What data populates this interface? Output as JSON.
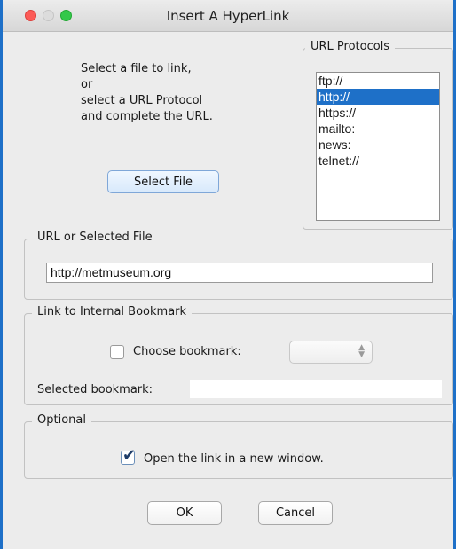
{
  "window": {
    "title": "Insert A HyperLink",
    "accent_color": "#1e70c8"
  },
  "instructions": [
    "Select a file to link,",
    "or",
    "select a URL Protocol",
    "and complete the URL."
  ],
  "select_file_button": "Select File",
  "url_protocols": {
    "legend": "URL Protocols",
    "items": [
      "ftp://",
      "http://",
      "https://",
      "mailto:",
      "news:",
      "telnet://"
    ],
    "selected": "http://"
  },
  "url_group": {
    "legend": "URL or Selected File",
    "value": "http://metmuseum.org"
  },
  "bookmark_group": {
    "legend": "Link to Internal Bookmark",
    "choose_label": "Choose bookmark:",
    "choose_checked": false,
    "selected_label": "Selected bookmark:",
    "selected_value": ""
  },
  "optional_group": {
    "legend": "Optional",
    "new_window_label": "Open the link in a new window.",
    "new_window_checked": true
  },
  "buttons": {
    "ok": "OK",
    "cancel": "Cancel"
  }
}
